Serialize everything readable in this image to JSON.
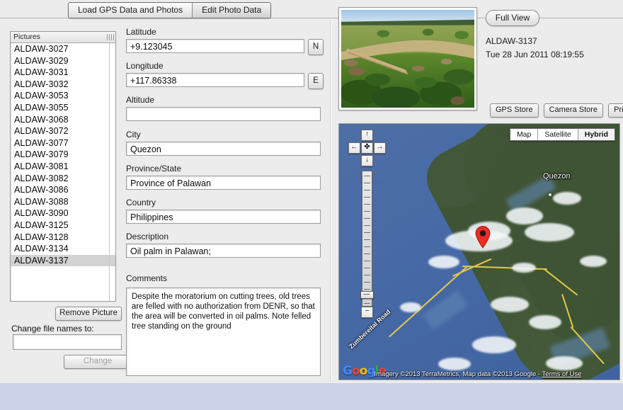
{
  "window": {
    "background": "#ececec",
    "page_background": "#ccd2e8"
  },
  "tabs": [
    {
      "label": "Load GPS Data and Photos",
      "selected": false
    },
    {
      "label": "Edit Photo Data",
      "selected": true
    }
  ],
  "pictures_panel": {
    "header": "Pictures",
    "items": [
      "ALDAW-3027",
      "ALDAW-3029",
      "ALDAW-3031",
      "ALDAW-3032",
      "ALDAW-3053",
      "ALDAW-3055",
      "ALDAW-3068",
      "ALDAW-3072",
      "ALDAW-3077",
      "ALDAW-3079",
      "ALDAW-3081",
      "ALDAW-3082",
      "ALDAW-3086",
      "ALDAW-3088",
      "ALDAW-3090",
      "ALDAW-3125",
      "ALDAW-3128",
      "ALDAW-3134",
      "ALDAW-3137"
    ],
    "selected": "ALDAW-3137",
    "remove_button": "Remove Picture",
    "rename_label": "Change file names to:",
    "rename_value": "",
    "rename_placeholder": "",
    "change_button": "Change",
    "change_button_disabled": true
  },
  "form": {
    "latitude": {
      "label": "Latitude",
      "value": "+9.123045",
      "hemisphere": "N"
    },
    "longitude": {
      "label": "Longitude",
      "value": "+117.86338",
      "hemisphere": "E"
    },
    "altitude": {
      "label": "Altitude",
      "value": ""
    },
    "city": {
      "label": "City",
      "value": "Quezon"
    },
    "province": {
      "label": "Province/State",
      "value": "Province of Palawan"
    },
    "country": {
      "label": "Country",
      "value": "Philippines"
    },
    "description": {
      "label": "Description",
      "value": "Oil palm in Palawan;"
    },
    "comments": {
      "label": "Comments",
      "value": "Despite the moratorium on cutting trees, old trees are felled with no authorization from DENR, so that the area will be converted in oil palms. Note felled tree standing on the ground"
    }
  },
  "photo_panel": {
    "full_view_button": "Full View",
    "photo_name": "ALDAW-3137",
    "photo_date": "Tue 28 Jun 2011 08:19:55",
    "buttons": [
      "GPS Store",
      "Camera Store",
      "Prints"
    ]
  },
  "map": {
    "types": [
      {
        "label": "Map",
        "active": false
      },
      {
        "label": "Satellite",
        "active": false
      },
      {
        "label": "Hybrid",
        "active": true
      }
    ],
    "controls": {
      "pan_up": "↑",
      "pan_left": "←",
      "pan_center": "✤",
      "pan_right": "→",
      "pan_down": "↓",
      "zoom_in": "+",
      "zoom_out": "−"
    },
    "place_label": "Quezon",
    "road_label": "Zumbereital Road",
    "attribution": "Imagery ©2013 TerraMetrics, Map data ©2013 Google - ",
    "terms_of_use": "Terms of Use",
    "logo_letters": [
      "G",
      "o",
      "o",
      "g",
      "l",
      "e"
    ],
    "marker_color": "#ee2b24"
  }
}
